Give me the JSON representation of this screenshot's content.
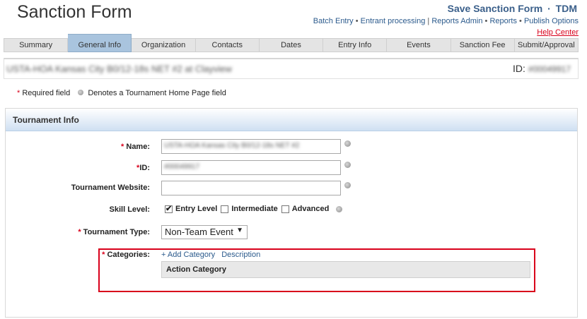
{
  "page": {
    "title": "Sanction Form",
    "save_label": "Save Sanction Form",
    "save_sep": "·",
    "tdm_label": "TDM",
    "help_center": "Help Center"
  },
  "top_links": [
    {
      "label": "Batch Entry",
      "sep": " • "
    },
    {
      "label": "Entrant processing",
      "sep": " | "
    },
    {
      "label": "Reports Admin",
      "sep": " • "
    },
    {
      "label": "Reports",
      "sep": " • "
    },
    {
      "label": "Publish Options",
      "sep": ""
    }
  ],
  "tabs": [
    {
      "label": "Summary"
    },
    {
      "label": "General Info"
    },
    {
      "label": "Organization"
    },
    {
      "label": "Contacts"
    },
    {
      "label": "Dates"
    },
    {
      "label": "Entry Info"
    },
    {
      "label": "Events"
    },
    {
      "label": "Sanction Fee"
    },
    {
      "label": "Submit/Approval"
    }
  ],
  "active_tab_index": 1,
  "info_bar": {
    "tournament_name": "USTA-HOA Kansas City B0/12-18s NET #2 at Clayview",
    "id_label": "ID:",
    "id_value": "#00049917"
  },
  "legend": {
    "asterisk": "*",
    "required_text": "Required field",
    "homepage_text": "Denotes a Tournament Home Page field"
  },
  "panel": {
    "header": "Tournament Info"
  },
  "form": {
    "name_label": "Name:",
    "name_value": "USTA-HOA Kansas City B0/12-18s NET #2",
    "id_label": "ID:",
    "id_value": "#00049917",
    "website_label": "Tournament Website:",
    "website_value": "",
    "skill_label": "Skill Level:",
    "skill_options": [
      {
        "label": "Entry Level",
        "checked": true
      },
      {
        "label": "Intermediate",
        "checked": false
      },
      {
        "label": "Advanced",
        "checked": false
      }
    ],
    "type_label": "Tournament Type:",
    "type_value": "Non-Team Event",
    "type_arrow": "▼",
    "categories_label": "Categories:",
    "add_category": "+ Add Category",
    "description": "Description",
    "action_category": "Action Category"
  },
  "colors": {
    "required": "#d9001b",
    "link": "#2b5a8c",
    "active_tab": "#a9c4de",
    "highlight_border": "#d9001b"
  },
  "icons": {
    "homepage": "homepage-field-icon",
    "dropdown": "chevron-down-icon"
  }
}
